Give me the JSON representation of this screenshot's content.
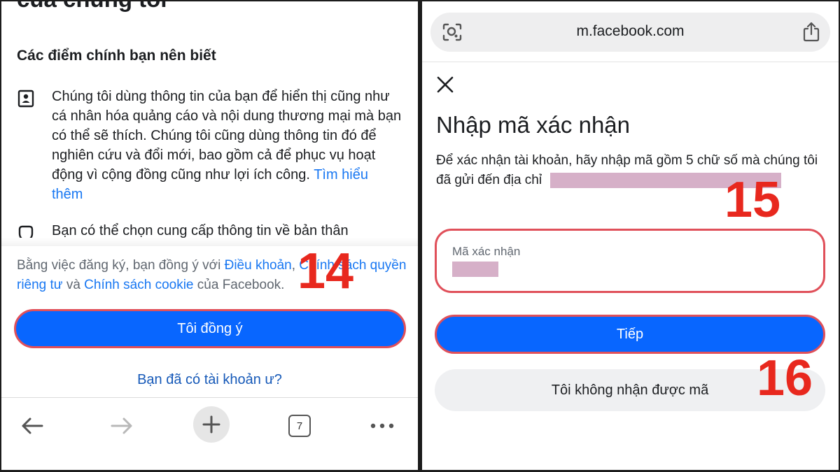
{
  "left": {
    "cut_heading": "của chúng tôi",
    "section_title": "Các điểm chính bạn nên biết",
    "bullet1_text": "Chúng tôi dùng thông tin của bạn để hiển thị cũng như cá nhân hóa quảng cáo và nội dung thương mại mà bạn có thể sẽ thích. Chúng tôi cũng dùng thông tin đó để nghiên cứu và đổi mới, bao gồm cả để phục vụ hoạt động vì cộng đồng cũng như lợi ích công.",
    "bullet1_link": "Tìm hiểu thêm",
    "bullet2_text": "Bạn có thể chọn cung cấp thông tin về bản thân",
    "terms": {
      "prefix": "Bằng việc đăng ký, bạn đồng ý với",
      "link_terms": "Điều khoản",
      "link_privacy": "Chính sách quyền riêng tư",
      "and": "và",
      "link_cookie": "Chính sách cookie",
      "suffix": "của Facebook."
    },
    "agree_label": "Tôi đồng ý",
    "have_account": "Bạn đã có tài khoản ư?",
    "tab_count": "7",
    "step_label": "14"
  },
  "right": {
    "url": "m.facebook.com",
    "title": "Nhập mã xác nhận",
    "instructions": "Để xác nhận tài khoản, hãy nhập mã gồm 5 chữ số mà chúng tôi đã gửi đến địa chỉ",
    "code_label": "Mã xác nhận",
    "next_label": "Tiếp",
    "no_code_label": "Tôi không nhận được mã",
    "step15": "15",
    "step16": "16"
  },
  "colors": {
    "primary": "#0866ff",
    "link": "#1877f2",
    "highlight": "#e0505a",
    "step_number": "#e8281e",
    "redaction": "#d6b0c8"
  },
  "icons": [
    "profile-icon",
    "shield-icon",
    "back-arrow-icon",
    "forward-arrow-icon",
    "plus-icon",
    "tabs-icon",
    "more-icon",
    "lens-icon",
    "share-icon",
    "close-icon"
  ]
}
